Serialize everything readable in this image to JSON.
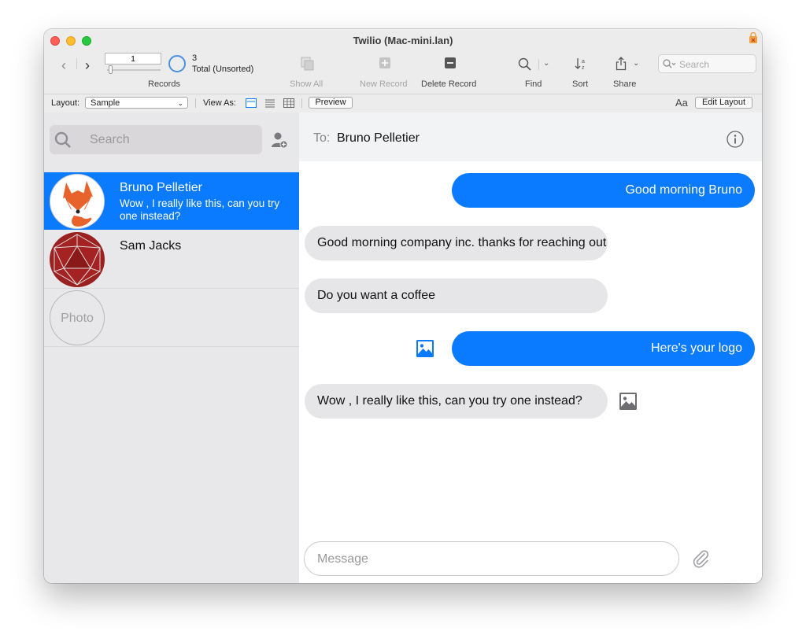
{
  "window": {
    "title": "Twilio (Mac-mini.lan)"
  },
  "toolbar": {
    "record_value": "1",
    "record_count": "3",
    "record_status": "Total (Unsorted)",
    "records_label": "Records",
    "show_all_label": "Show All",
    "new_record_label": "New Record",
    "delete_record_label": "Delete Record",
    "find_label": "Find",
    "sort_label": "Sort",
    "share_label": "Share",
    "search_placeholder": "Search"
  },
  "layout_bar": {
    "layout_label": "Layout:",
    "layout_value": "Sample",
    "view_as_label": "View As:",
    "preview_label": "Preview",
    "font_icon_text": "Aa",
    "edit_layout_label": "Edit Layout"
  },
  "sidebar": {
    "search_placeholder": "Search",
    "contacts": [
      {
        "name": "Bruno Pelletier",
        "preview": "Wow , I really like this, can you try one instead?",
        "avatar": "fox-avatar",
        "selected": true
      },
      {
        "name": "Sam Jacks",
        "preview": "",
        "avatar": "d20-avatar",
        "selected": false
      },
      {
        "name": "",
        "preview": "",
        "avatar_placeholder": "Photo",
        "selected": false
      }
    ]
  },
  "chat": {
    "to_label": "To:",
    "to_name": "Bruno Pelletier",
    "messages": [
      {
        "direction": "outgoing",
        "text": "Good morning Bruno"
      },
      {
        "direction": "incoming",
        "text": "Good morning company inc. thanks for reaching out"
      },
      {
        "direction": "incoming",
        "text": "Do you want a coffee"
      },
      {
        "direction": "outgoing",
        "text": "Here's your logo",
        "attachment_icon": "image-icon"
      },
      {
        "direction": "incoming",
        "text": "Wow , I really like this, can you try one instead?",
        "attachment_icon": "image-icon"
      }
    ],
    "message_placeholder": "Message"
  },
  "colors": {
    "accent": "#0a7aff",
    "incoming_bubble": "#e6e6e8",
    "sidebar_bg": "#e8e8ea"
  }
}
